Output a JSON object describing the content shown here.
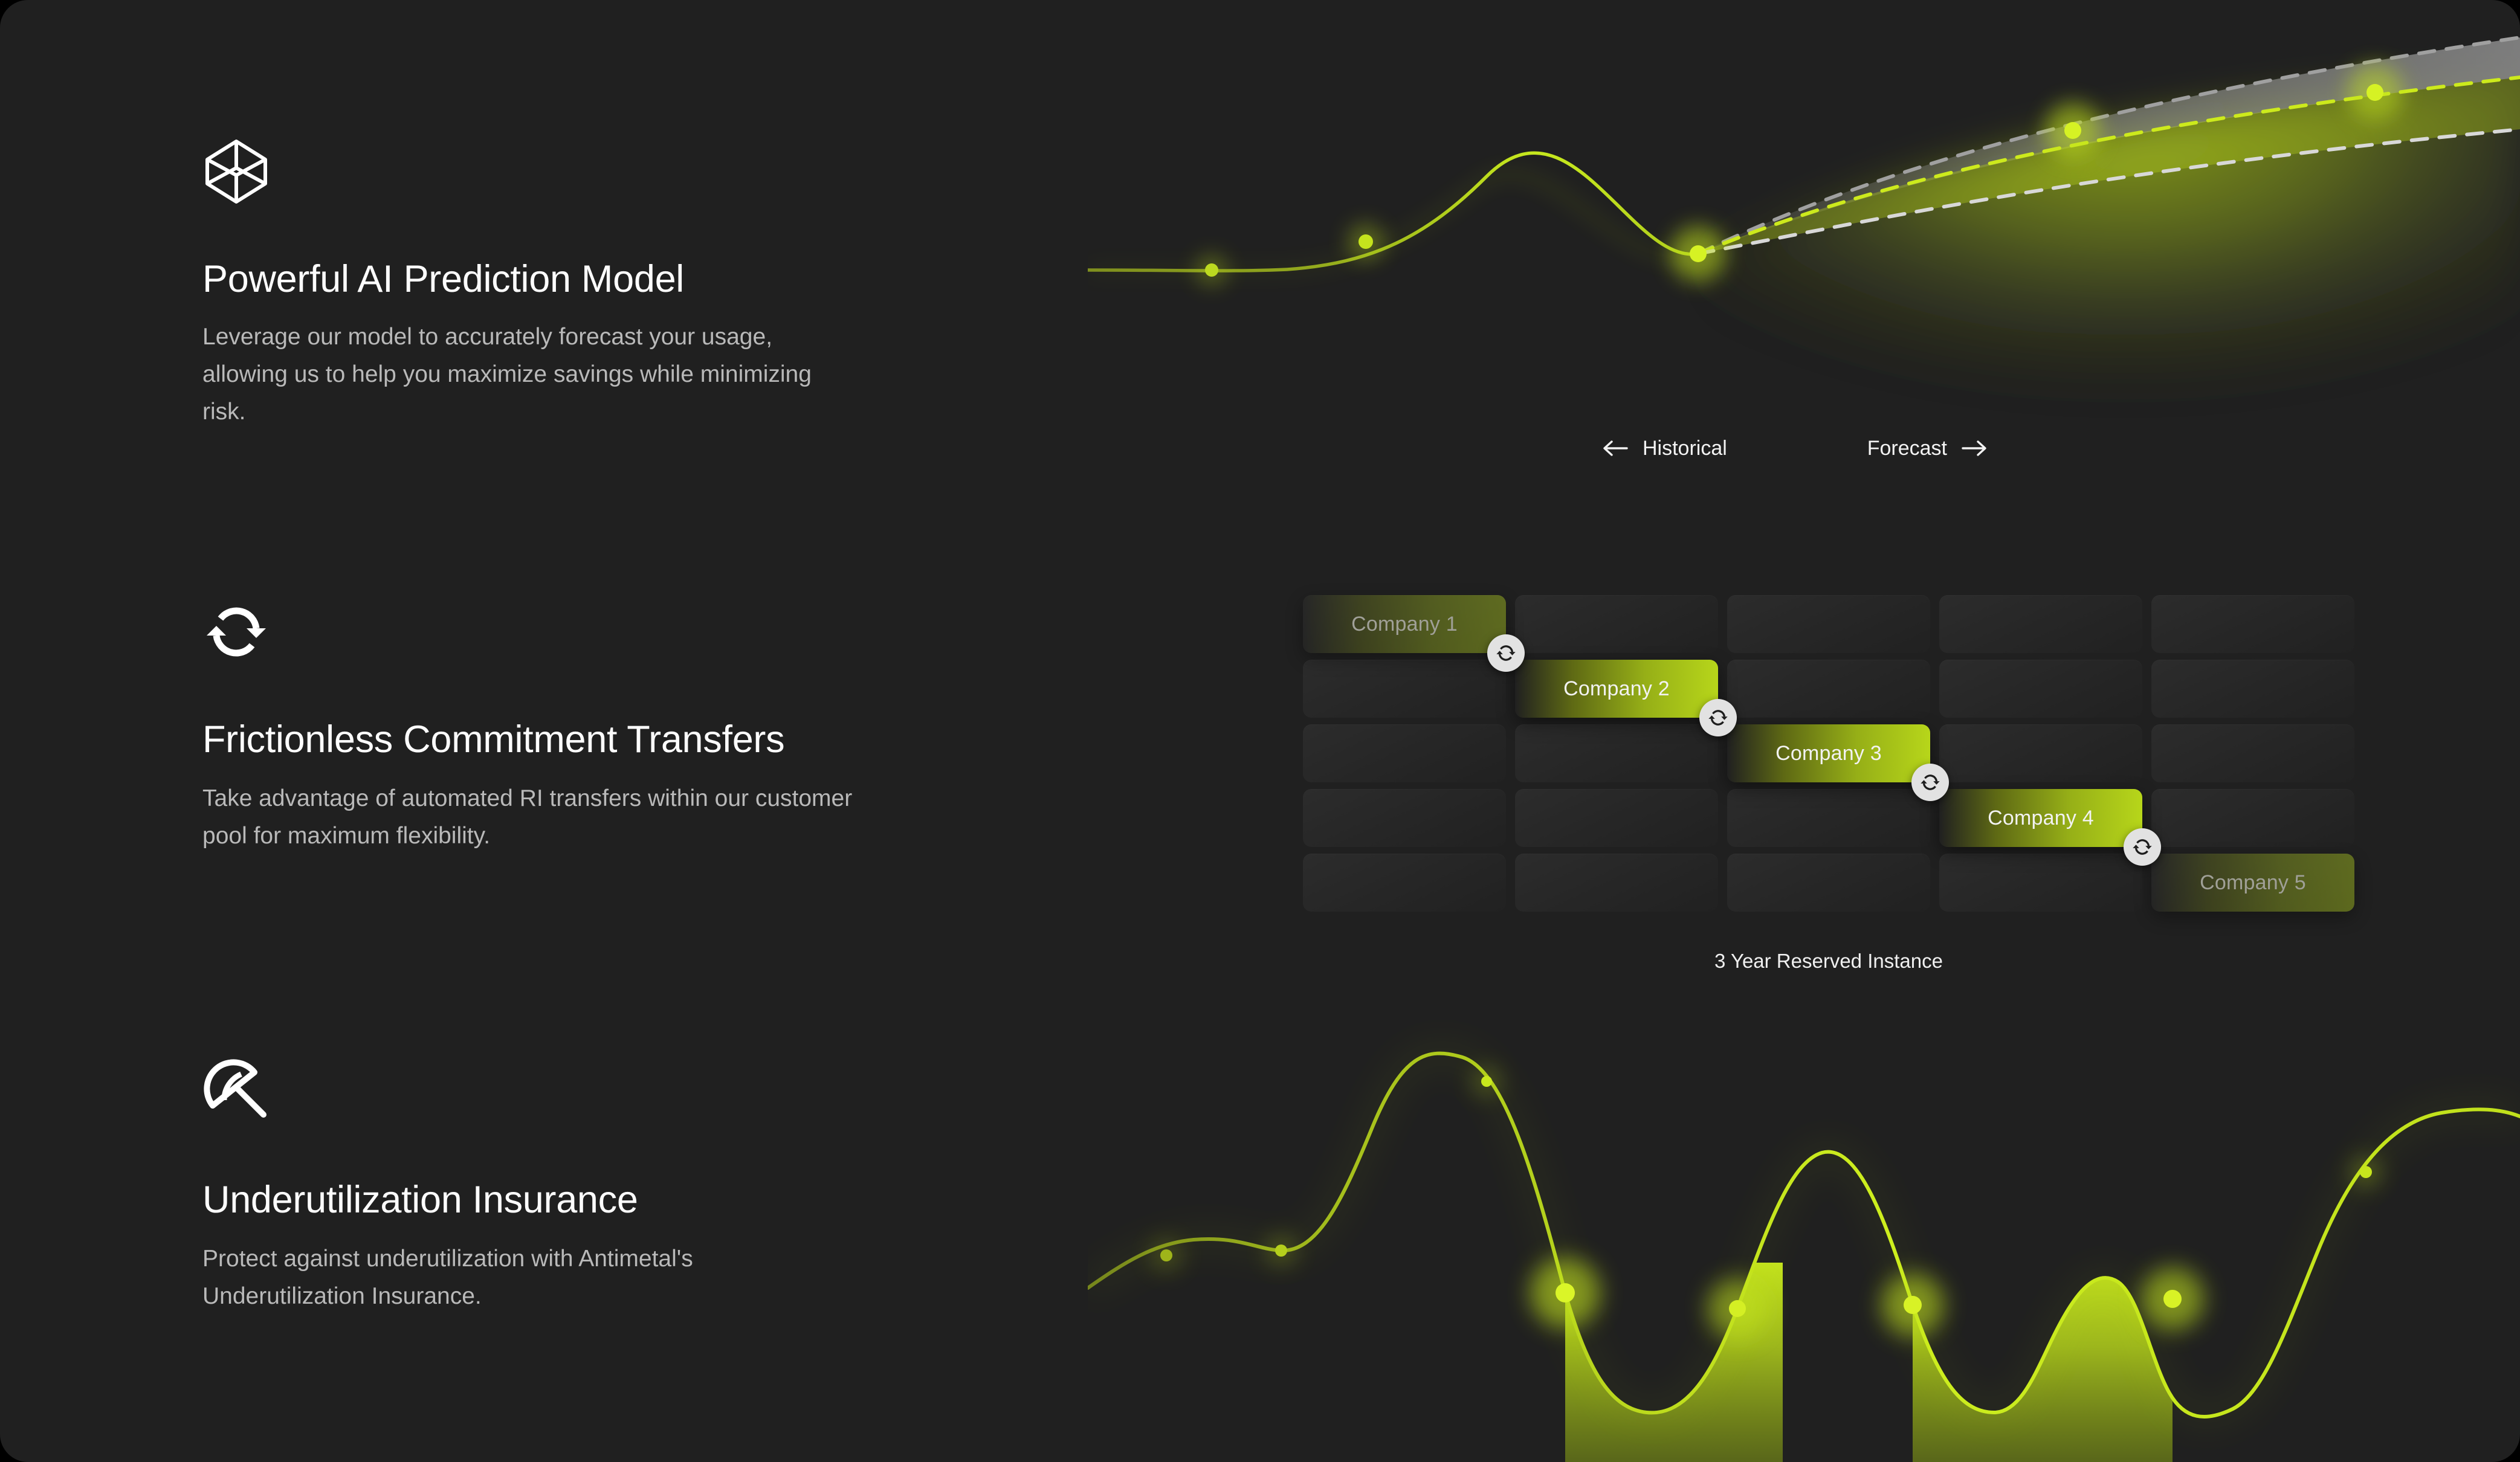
{
  "theme": {
    "background": "#202020",
    "accent": "#c3e31c",
    "accent_dim": "#6f7d17",
    "text_primary": "#fdfdfd",
    "text_secondary": "#b9b9b9",
    "cell": "#2a2a2a",
    "badge": "#e2e2e2"
  },
  "features": [
    {
      "icon": "cube-wireframe-icon",
      "title": "Powerful AI Prediction Model",
      "description": "Leverage our model to accurately forecast your usage, allowing us to help you maximize savings while minimizing risk."
    },
    {
      "icon": "sync-arrows-icon",
      "title": "Frictionless Commitment Transfers",
      "description": "Take advantage of automated RI transfers within our customer pool for maximum flexibility."
    },
    {
      "icon": "beach-umbrella-icon",
      "title": "Underutilization Insurance",
      "description": "Protect against underutilization with Antimetal's Underutilization Insurance."
    }
  ],
  "prediction_chart": {
    "legend_historical": "Historical",
    "legend_forecast": "Forecast",
    "left_arrow_icon": "arrow-left-icon",
    "right_arrow_icon": "arrow-right-icon"
  },
  "transfers_grid": {
    "caption": "3 Year Reserved Instance",
    "columns": 5,
    "rows": 5,
    "blocks": [
      {
        "label": "Company 1",
        "row": 0,
        "col": 0,
        "dim": true
      },
      {
        "label": "Company 2",
        "row": 1,
        "col": 1,
        "dim": false
      },
      {
        "label": "Company 3",
        "row": 2,
        "col": 2,
        "dim": false
      },
      {
        "label": "Company 4",
        "row": 3,
        "col": 3,
        "dim": false
      },
      {
        "label": "Company 5",
        "row": 4,
        "col": 4,
        "dim": true
      }
    ],
    "sync_badge_icon": "sync-arrows-icon",
    "sync_badge_count": 4
  },
  "chart_data": [
    {
      "type": "line",
      "name": "prediction-forecast-curve",
      "title": "",
      "xlabel": "",
      "ylabel": "",
      "xlim": [
        0,
        100
      ],
      "ylim": [
        0,
        100
      ],
      "grid": false,
      "legend": [
        "Historical",
        "Forecast"
      ],
      "legend_position": "bottom-center",
      "series": [
        {
          "name": "Historical",
          "style": "solid",
          "color": "#c3e31c",
          "x": [
            0,
            6,
            12,
            18,
            24,
            30,
            36,
            42,
            48,
            54,
            58
          ],
          "y": [
            9,
            9.5,
            10,
            11,
            14,
            20,
            30,
            44,
            58,
            70,
            76
          ]
        },
        {
          "name": "Forecast",
          "style": "dashed",
          "color": "#c3e31c",
          "x": [
            58,
            66,
            74,
            82,
            90,
            100
          ],
          "y": [
            76,
            82,
            87,
            91,
            94,
            96
          ]
        },
        {
          "name": "Upper bound",
          "style": "dashed",
          "color": "#9a9a9a",
          "x": [
            58,
            66,
            74,
            82,
            90,
            100
          ],
          "y": [
            76,
            84,
            90.5,
            95,
            98.5,
            100.5
          ]
        },
        {
          "name": "Lower bound",
          "style": "dashed",
          "color": "#cfcfcf",
          "x": [
            58,
            66,
            74,
            82,
            90,
            100
          ],
          "y": [
            76,
            80.5,
            84,
            86.5,
            88.5,
            90
          ]
        }
      ],
      "markers_x": [
        12,
        36,
        58,
        74,
        90
      ],
      "markers_y": [
        10,
        30,
        76,
        87,
        94
      ]
    },
    {
      "type": "area",
      "name": "underutilization-curve",
      "title": "",
      "xlabel": "",
      "ylabel": "",
      "xlim": [
        0,
        100
      ],
      "ylim": [
        0,
        100
      ],
      "grid": false,
      "threshold": 46,
      "threshold_label": "",
      "series": [
        {
          "name": "Usage",
          "style": "solid",
          "color": "#c3e31c",
          "fill_below_threshold": true,
          "x": [
            0,
            4,
            8,
            12,
            16,
            20,
            24,
            28,
            32,
            36,
            40,
            44,
            48,
            52,
            56,
            60,
            64,
            68,
            72,
            76,
            80,
            84,
            88,
            92,
            96,
            100
          ],
          "y": [
            30,
            40,
            52,
            54,
            52,
            62,
            84,
            92,
            86,
            68,
            46,
            28,
            20,
            26,
            46,
            72,
            86,
            78,
            58,
            46,
            32,
            40,
            30,
            46,
            72,
            84
          ]
        }
      ],
      "markers_x": [
        4,
        20,
        40,
        56,
        60,
        76,
        92
      ],
      "markers_y": [
        40,
        62,
        46,
        46,
        72,
        46,
        46
      ]
    }
  ]
}
